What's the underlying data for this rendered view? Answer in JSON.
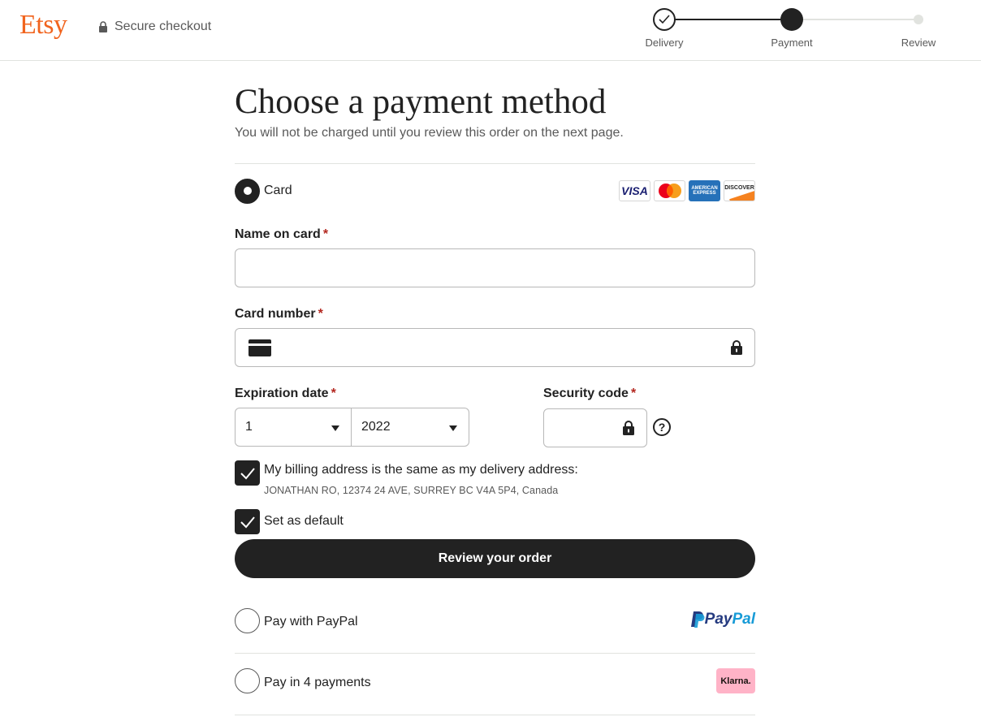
{
  "header": {
    "logo": "Etsy",
    "secure_label": "Secure checkout",
    "steps": [
      {
        "label": "Delivery",
        "state": "complete"
      },
      {
        "label": "Payment",
        "state": "current"
      },
      {
        "label": "Review",
        "state": "upcoming"
      }
    ]
  },
  "page": {
    "title": "Choose a payment method",
    "subtitle": "You will not be charged until you review this order on the next page."
  },
  "card_option": {
    "label": "Card",
    "selected": true,
    "logos": [
      "visa",
      "mastercard",
      "american-express",
      "discover"
    ],
    "visa_text": "VISA",
    "amex_text": "AMERICAN EXPRESS",
    "discover_text": "DISCOVER"
  },
  "form": {
    "name_on_card": {
      "label": "Name on card",
      "required": "*",
      "value": ""
    },
    "card_number": {
      "label": "Card number",
      "required": "*",
      "value": ""
    },
    "expiration": {
      "label": "Expiration date",
      "required": "*",
      "month": "1",
      "year": "2022"
    },
    "security_code": {
      "label": "Security code",
      "required": "*",
      "value": "",
      "help": "?"
    },
    "billing_same": {
      "label": "My billing address is the same as my delivery address:",
      "address": "JONATHAN RO, 12374 24 AVE, SURREY BC V4A 5P4, Canada",
      "checked": true
    },
    "set_default": {
      "label": "Set as default",
      "checked": true
    },
    "submit_label": "Review your order"
  },
  "paypal_option": {
    "label": "Pay with PayPal",
    "logo_pay": "Pay",
    "logo_pal": "Pal",
    "selected": false
  },
  "klarna_option": {
    "label": "Pay in 4 payments",
    "logo": "Klarna.",
    "selected": false
  },
  "colors": {
    "brand": "#f1641e",
    "text": "#222222",
    "muted": "#595959",
    "required": "#b3261e",
    "klarna_pink": "#ffb3c7"
  }
}
